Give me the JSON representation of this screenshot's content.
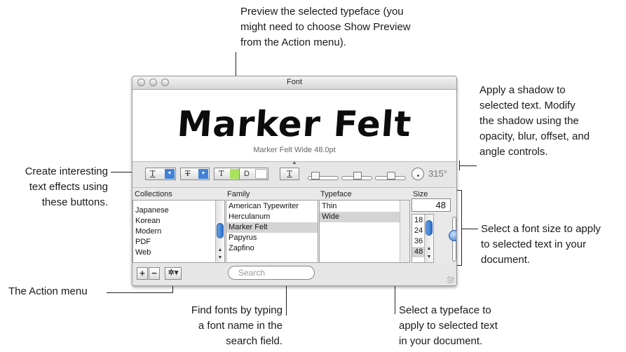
{
  "callouts": {
    "preview": [
      "Preview the selected typeface (you",
      "might need to choose Show Preview",
      "from the Action menu)."
    ],
    "shadow": [
      "Apply a shadow to",
      "selected text. Modify",
      "the shadow using the",
      "opacity, blur, offset, and",
      "angle controls."
    ],
    "effects": [
      "Create interesting",
      "text effects using",
      "these buttons."
    ],
    "size": [
      "Select a font size to apply",
      "to selected text in your",
      "document."
    ],
    "action": "The Action menu",
    "search": [
      "Find fonts by typing",
      "a font name in the",
      "search field."
    ],
    "typeface": [
      "Select a typeface to",
      "apply to selected text",
      "in your document."
    ]
  },
  "window": {
    "title": "Font",
    "preview_text": "Marker Felt",
    "preview_caption": "Marker Felt Wide 48.0pt",
    "shadow_angle": "315°"
  },
  "columns": {
    "collections": {
      "header": "Collections",
      "items": [
        "Japanese",
        "Korean",
        "Modern",
        "PDF",
        "Web"
      ]
    },
    "family": {
      "header": "Family",
      "items": [
        "American Typewriter",
        "Herculanum",
        "Marker Felt",
        "Papyrus",
        "Zapfino"
      ],
      "selected": 2
    },
    "typeface": {
      "header": "Typeface",
      "items": [
        "Thin",
        "Wide"
      ],
      "selected": 1
    },
    "size": {
      "header": "Size",
      "value": "48",
      "items": [
        "18",
        "24",
        "36",
        "48"
      ],
      "selected": 3
    }
  },
  "toolbar": {
    "underline_glyph": "T",
    "strike_glyph": "T",
    "text_color_glyph": "T",
    "doc_glyph": "D",
    "shadow_glyph": "T",
    "text_color_swatch": "#a7e35a",
    "accent": "#3f82d8"
  },
  "bottom": {
    "add": "+",
    "remove": "−",
    "action_icon": "gear-icon",
    "search_placeholder": "Search"
  }
}
